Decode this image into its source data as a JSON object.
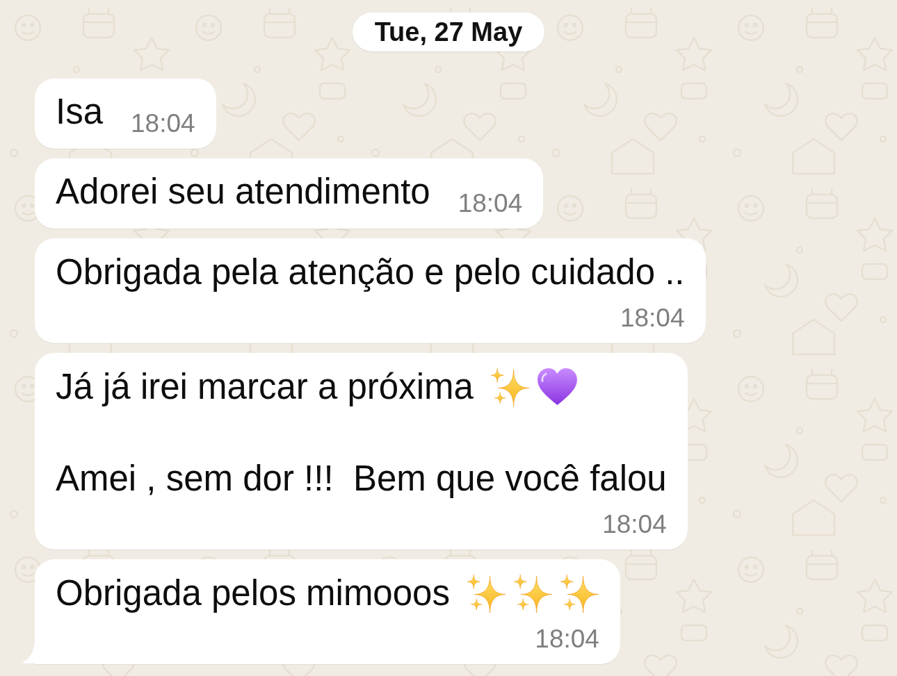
{
  "date_divider": "Tue, 27 May",
  "messages": [
    {
      "kind": "compact",
      "paragraphs": [
        [
          {
            "kind": "text",
            "text": "Isa"
          }
        ]
      ],
      "time": "18:04",
      "tail": false
    },
    {
      "kind": "compact",
      "paragraphs": [
        [
          {
            "kind": "text",
            "text": "Adorei seu atendimento"
          }
        ]
      ],
      "time": "18:04",
      "tail": false
    },
    {
      "kind": "stacked",
      "paragraphs": [
        [
          {
            "kind": "text",
            "text": "Obrigada pela atenção e pelo cuidado .."
          }
        ]
      ],
      "time": "18:04",
      "tail": false
    },
    {
      "kind": "stacked",
      "paragraphs": [
        [
          {
            "kind": "text",
            "text": "Já já irei marcar a próxima"
          },
          {
            "kind": "sparkles"
          },
          {
            "kind": "heart"
          }
        ],
        [
          {
            "kind": "text",
            "text": "Amei , sem dor !!!  Bem que você falou"
          }
        ]
      ],
      "time": "18:04",
      "tail": false
    },
    {
      "kind": "stacked",
      "paragraphs": [
        [
          {
            "kind": "text",
            "text": "Obrigada pelos mimooos"
          },
          {
            "kind": "sparkles"
          },
          {
            "kind": "sparkles"
          },
          {
            "kind": "sparkles"
          }
        ]
      ],
      "time": "18:04",
      "tail": true
    }
  ]
}
